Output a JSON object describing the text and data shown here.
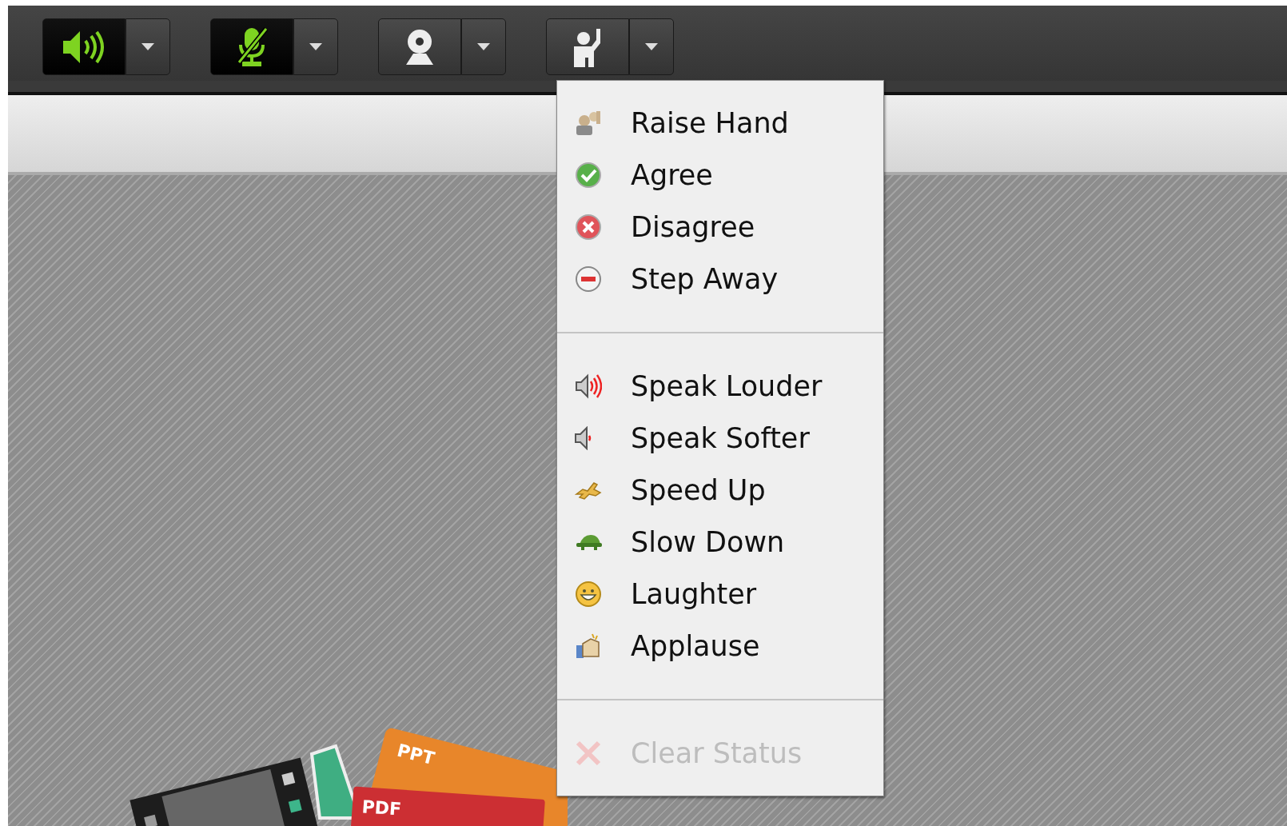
{
  "toolbar": {
    "buttons": [
      {
        "kind": "speaker",
        "active": true
      },
      {
        "kind": "microphone",
        "active": true
      },
      {
        "kind": "camera",
        "active": false
      },
      {
        "kind": "hand",
        "active": false
      }
    ]
  },
  "status_menu": {
    "sections": [
      {
        "items": [
          {
            "kind": "raise-hand",
            "label": "Raise Hand",
            "disabled": false
          },
          {
            "kind": "agree",
            "label": "Agree",
            "disabled": false
          },
          {
            "kind": "disagree",
            "label": "Disagree",
            "disabled": false
          },
          {
            "kind": "step-away",
            "label": "Step Away",
            "disabled": false
          }
        ]
      },
      {
        "items": [
          {
            "kind": "louder",
            "label": "Speak Louder",
            "disabled": false
          },
          {
            "kind": "softer",
            "label": "Speak Softer",
            "disabled": false
          },
          {
            "kind": "speed-up",
            "label": "Speed Up",
            "disabled": false
          },
          {
            "kind": "slow-down",
            "label": "Slow Down",
            "disabled": false
          },
          {
            "kind": "laughter",
            "label": "Laughter",
            "disabled": false
          },
          {
            "kind": "applause",
            "label": "Applause",
            "disabled": false
          }
        ]
      },
      {
        "items": [
          {
            "kind": "clear",
            "label": "Clear Status",
            "disabled": true
          }
        ]
      }
    ]
  },
  "artwork_labels": [
    "PPT",
    "PDF"
  ]
}
